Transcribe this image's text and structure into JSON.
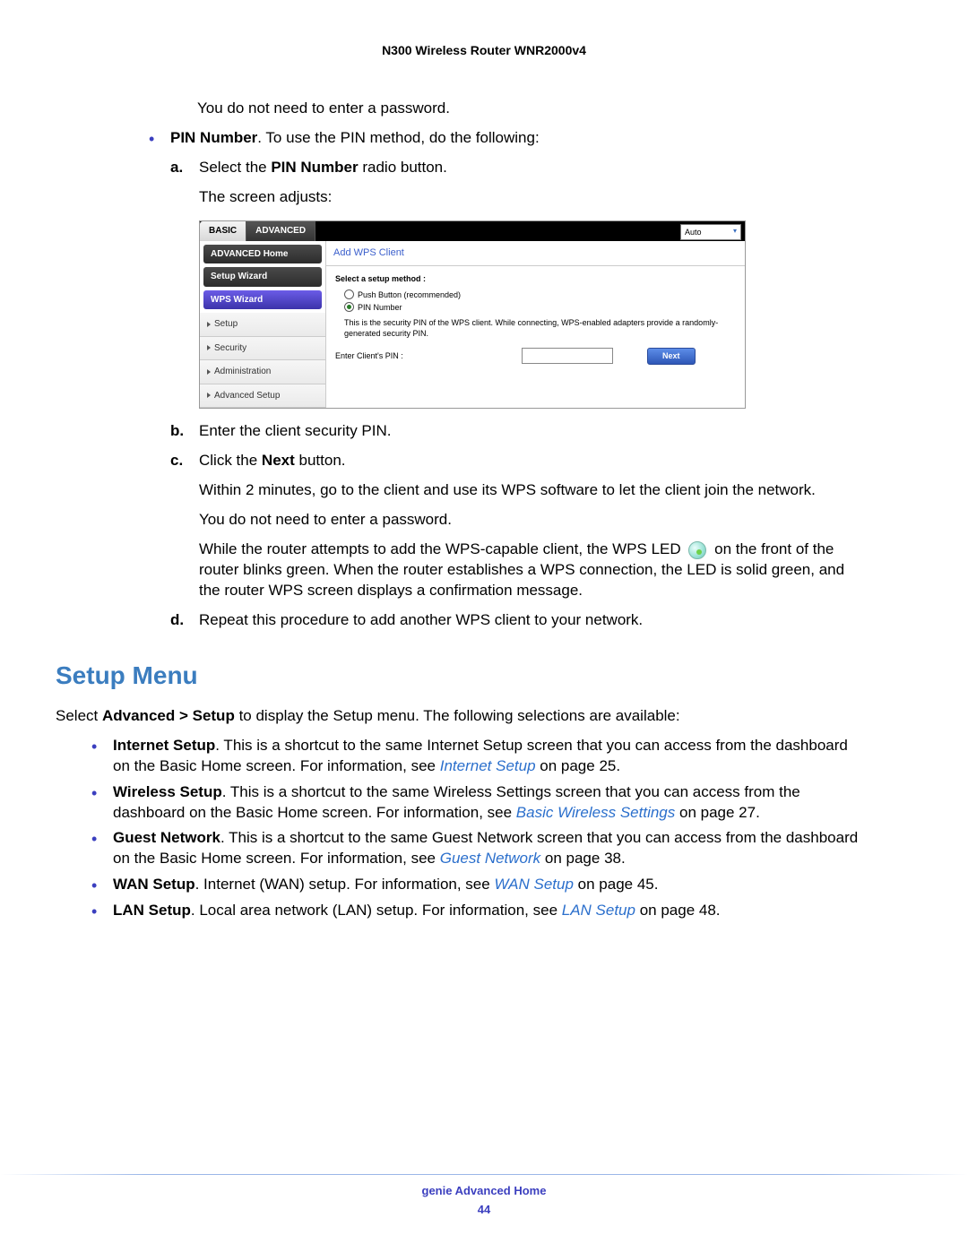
{
  "doc_header": "N300 Wireless Router WNR2000v4",
  "intro1": "You do not need to enter a password.",
  "pin_bullet_bold": "PIN Number",
  "pin_bullet_rest": ". To use the PIN method, do the following:",
  "step_a_pre": "Select the ",
  "step_a_bold": "PIN Number",
  "step_a_post": " radio button.",
  "screen_adjusts": "The screen adjusts:",
  "ui": {
    "tab_basic": "BASIC",
    "tab_advanced": "ADVANCED",
    "dropdown_value": "Auto",
    "side": {
      "adv_home": "ADVANCED Home",
      "setup_wizard": "Setup Wizard",
      "wps_wizard": "WPS Wizard",
      "setup": "Setup",
      "security": "Security",
      "administration": "Administration",
      "advanced_setup": "Advanced Setup"
    },
    "panel_title": "Add WPS Client",
    "select_method": "Select a setup method :",
    "radio_push": "Push Button (recommended)",
    "radio_pin": "PIN Number",
    "help": "This is the security PIN of the WPS client. While connecting, WPS-enabled adapters provide a randomly-generated security PIN.",
    "pin_label": "Enter Client's PIN :",
    "next_btn": "Next"
  },
  "step_b": "Enter the client security PIN.",
  "step_c_pre": "Click the ",
  "step_c_bold": "Next",
  "step_c_post": " button.",
  "step_c_para": "Within 2 minutes, go to the client and use its WPS software to let the client join the network.",
  "no_password2": "You do not need to enter a password.",
  "wps_led_pre": "While the router attempts to add the WPS-capable client, the WPS LED ",
  "wps_led_post": " on the front of the router blinks green. When the router establishes a WPS connection, the LED is solid green, and the router WPS screen displays a confirmation message.",
  "step_d": "Repeat this procedure to add another WPS client to your network.",
  "h2": "Setup Menu",
  "setup_intro_pre": "Select ",
  "setup_intro_bold": "Advanced > Setup",
  "setup_intro_post": " to display the Setup menu. The following selections are available:",
  "setup_items": {
    "internet": {
      "bold": "Internet Setup",
      "text": ". This is a shortcut to the same Internet Setup screen that you can access from the dashboard on the Basic Home screen. For information, see ",
      "link": "Internet Setup",
      "after": " on page 25."
    },
    "wireless": {
      "bold": "Wireless Setup",
      "text": ". This is a shortcut to the same Wireless Settings screen that you can access from the dashboard on the Basic Home screen. For information, see ",
      "link": "Basic Wireless Settings",
      "after": " on page 27."
    },
    "guest": {
      "bold": "Guest Network",
      "text": ". This is a shortcut to the same Guest Network screen that you can access from the dashboard on the Basic Home screen. For information, see ",
      "link": "Guest Network",
      "after": " on page 38."
    },
    "wan": {
      "bold": "WAN Setup",
      "text": ". Internet (WAN) setup. For information, see ",
      "link": "WAN Setup",
      "after": " on page 45."
    },
    "lan": {
      "bold": "LAN Setup",
      "text": ". Local area network (LAN) setup. For information, see ",
      "link": "LAN Setup",
      "after": " on page 48."
    }
  },
  "footer_title": "genie Advanced Home",
  "footer_page": "44"
}
